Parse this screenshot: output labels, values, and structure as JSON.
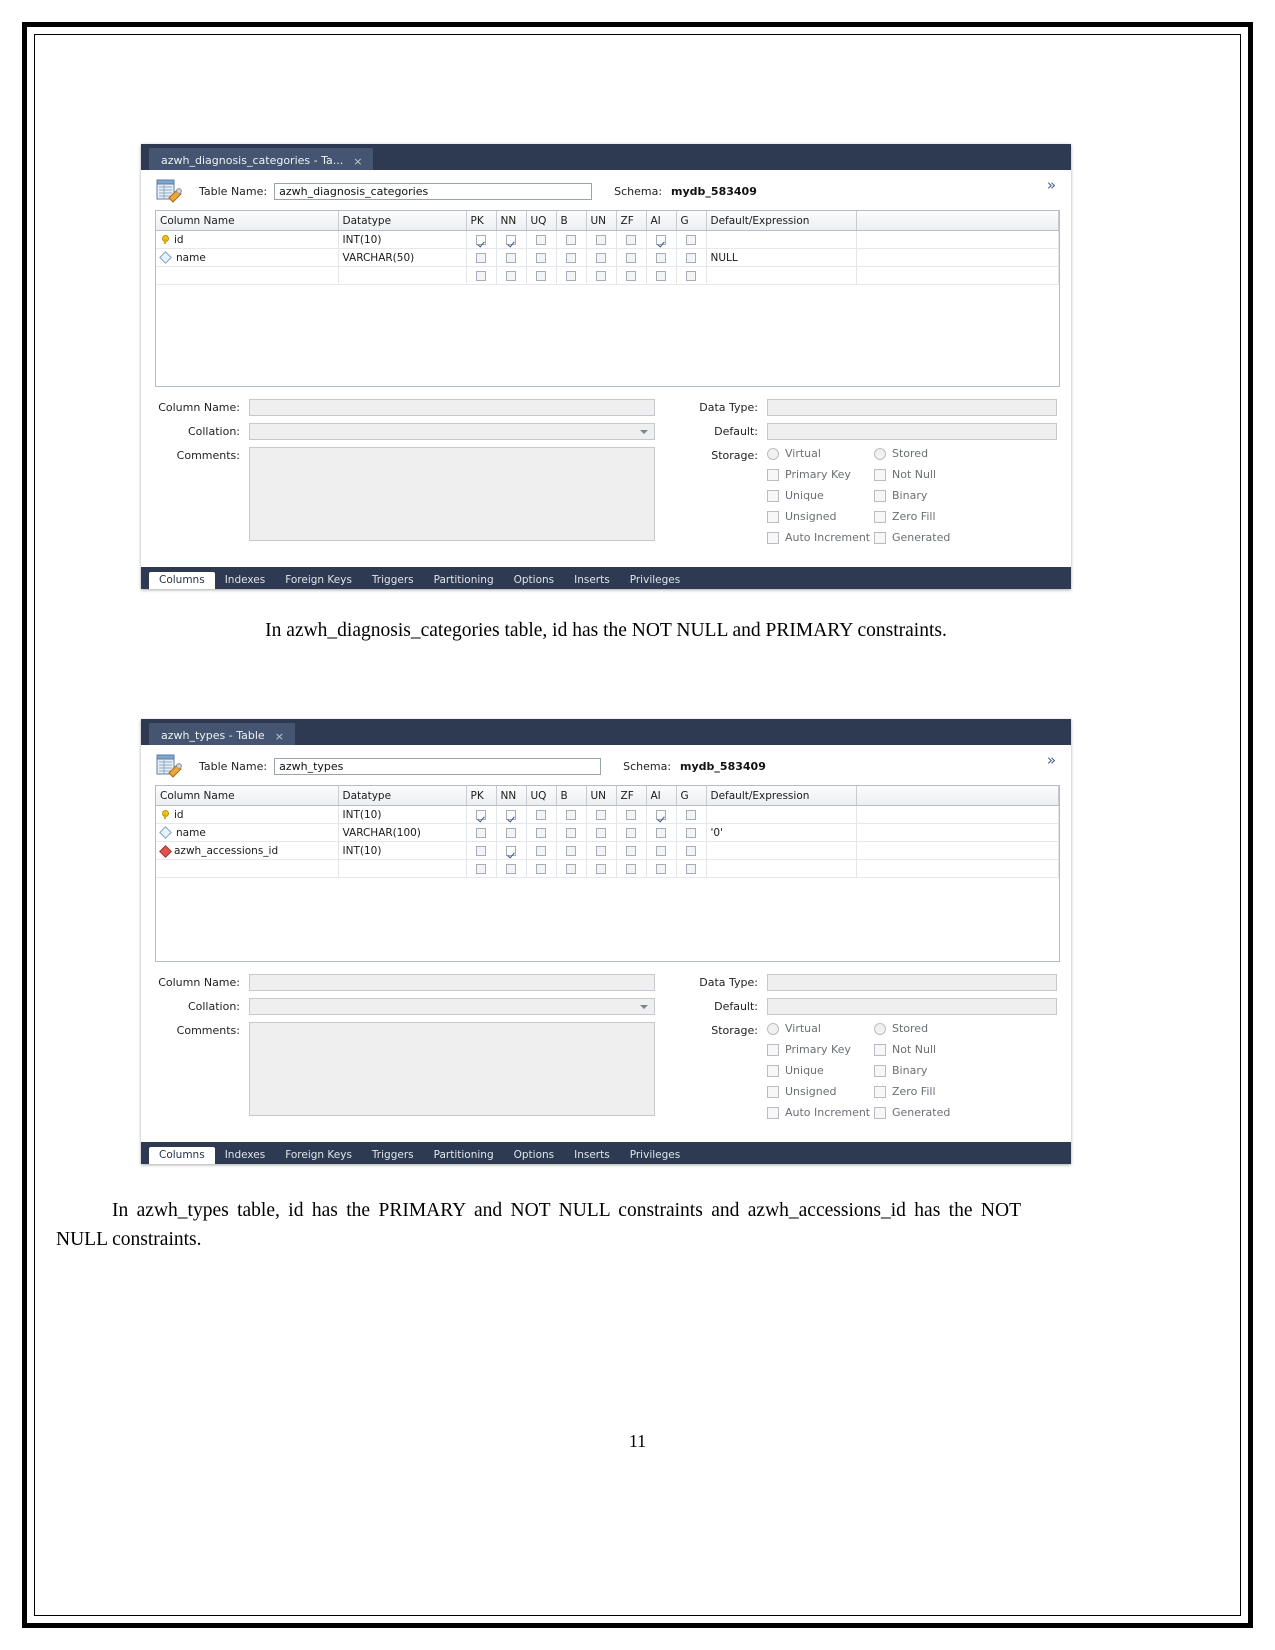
{
  "document": {
    "page_number": "11"
  },
  "figure1": {
    "tab_title": "azwh_diagnosis_categories - Ta...",
    "close_glyph": "×",
    "table_name_label": "Table Name:",
    "table_name_value": "azwh_diagnosis_categories",
    "schema_label": "Schema:",
    "schema_value": "mydb_583409",
    "collapse_glyph": "»",
    "grid": {
      "headers": [
        "Column Name",
        "Datatype",
        "PK",
        "NN",
        "UQ",
        "B",
        "UN",
        "ZF",
        "AI",
        "G",
        "Default/Expression"
      ],
      "rows": [
        {
          "icon": "primary-key-icon",
          "name": "id",
          "datatype": "INT(10)",
          "pk": true,
          "nn": true,
          "uq": false,
          "b": false,
          "un": false,
          "zf": false,
          "ai": true,
          "g": false,
          "default": ""
        },
        {
          "icon": "nullable-icon",
          "name": "name",
          "datatype": "VARCHAR(50)",
          "pk": false,
          "nn": false,
          "uq": false,
          "b": false,
          "un": false,
          "zf": false,
          "ai": false,
          "g": false,
          "default": "NULL"
        },
        {
          "icon": "",
          "name": "",
          "datatype": "",
          "pk": false,
          "nn": false,
          "uq": false,
          "b": false,
          "un": false,
          "zf": false,
          "ai": false,
          "g": false,
          "default": ""
        }
      ]
    },
    "detail": {
      "column_name_label": "Column Name:",
      "column_name_value": "",
      "collation_label": "Collation:",
      "collation_value": "",
      "comments_label": "Comments:",
      "comments_value": "",
      "data_type_label": "Data Type:",
      "data_type_value": "",
      "default_label": "Default:",
      "default_value": "",
      "storage_label": "Storage:",
      "options": [
        {
          "kind": "radio",
          "label": "Virtual",
          "checked": false
        },
        {
          "kind": "radio",
          "label": "Stored",
          "checked": false
        },
        {
          "kind": "checkbox",
          "label": "Primary Key",
          "checked": false
        },
        {
          "kind": "checkbox",
          "label": "Not Null",
          "checked": false
        },
        {
          "kind": "checkbox",
          "label": "Unique",
          "checked": false
        },
        {
          "kind": "checkbox",
          "label": "Binary",
          "checked": false
        },
        {
          "kind": "checkbox",
          "label": "Unsigned",
          "checked": false
        },
        {
          "kind": "checkbox",
          "label": "Zero Fill",
          "checked": false
        },
        {
          "kind": "checkbox",
          "label": "Auto Increment",
          "checked": false
        },
        {
          "kind": "checkbox",
          "label": "Generated",
          "checked": false
        }
      ]
    },
    "bottom_tabs": [
      {
        "label": "Columns",
        "active": true
      },
      {
        "label": "Indexes",
        "active": false
      },
      {
        "label": "Foreign Keys",
        "active": false
      },
      {
        "label": "Triggers",
        "active": false
      },
      {
        "label": "Partitioning",
        "active": false
      },
      {
        "label": "Options",
        "active": false
      },
      {
        "label": "Inserts",
        "active": false
      },
      {
        "label": "Privileges",
        "active": false
      }
    ],
    "caption": "In azwh_diagnosis_categories table, id has the NOT NULL and PRIMARY constraints."
  },
  "figure2": {
    "tab_title": "azwh_types - Table",
    "close_glyph": "×",
    "table_name_label": "Table Name:",
    "table_name_value": "azwh_types",
    "schema_label": "Schema:",
    "schema_value": "mydb_583409",
    "collapse_glyph": "»",
    "grid": {
      "headers": [
        "Column Name",
        "Datatype",
        "PK",
        "NN",
        "UQ",
        "B",
        "UN",
        "ZF",
        "AI",
        "G",
        "Default/Expression"
      ],
      "rows": [
        {
          "icon": "primary-key-icon",
          "name": "id",
          "datatype": "INT(10)",
          "pk": true,
          "nn": true,
          "uq": false,
          "b": false,
          "un": false,
          "zf": false,
          "ai": true,
          "g": false,
          "default": ""
        },
        {
          "icon": "nullable-icon",
          "name": "name",
          "datatype": "VARCHAR(100)",
          "pk": false,
          "nn": false,
          "uq": false,
          "b": false,
          "un": false,
          "zf": false,
          "ai": false,
          "g": false,
          "default": "'0'"
        },
        {
          "icon": "foreign-key-icon",
          "name": "azwh_accessions_id",
          "datatype": "INT(10)",
          "pk": false,
          "nn": true,
          "uq": false,
          "b": false,
          "un": false,
          "zf": false,
          "ai": false,
          "g": false,
          "default": ""
        },
        {
          "icon": "",
          "name": "",
          "datatype": "",
          "pk": false,
          "nn": false,
          "uq": false,
          "b": false,
          "un": false,
          "zf": false,
          "ai": false,
          "g": false,
          "default": ""
        }
      ]
    },
    "detail": {
      "column_name_label": "Column Name:",
      "column_name_value": "",
      "collation_label": "Collation:",
      "collation_value": "",
      "comments_label": "Comments:",
      "comments_value": "",
      "data_type_label": "Data Type:",
      "data_type_value": "",
      "default_label": "Default:",
      "default_value": "",
      "storage_label": "Storage:",
      "options": [
        {
          "kind": "radio",
          "label": "Virtual",
          "checked": false
        },
        {
          "kind": "radio",
          "label": "Stored",
          "checked": false
        },
        {
          "kind": "checkbox",
          "label": "Primary Key",
          "checked": false
        },
        {
          "kind": "checkbox",
          "label": "Not Null",
          "checked": false
        },
        {
          "kind": "checkbox",
          "label": "Unique",
          "checked": false
        },
        {
          "kind": "checkbox",
          "label": "Binary",
          "checked": false
        },
        {
          "kind": "checkbox",
          "label": "Unsigned",
          "checked": false
        },
        {
          "kind": "checkbox",
          "label": "Zero Fill",
          "checked": false
        },
        {
          "kind": "checkbox",
          "label": "Auto Increment",
          "checked": false
        },
        {
          "kind": "checkbox",
          "label": "Generated",
          "checked": false
        }
      ]
    },
    "bottom_tabs": [
      {
        "label": "Columns",
        "active": true
      },
      {
        "label": "Indexes",
        "active": false
      },
      {
        "label": "Foreign Keys",
        "active": false
      },
      {
        "label": "Triggers",
        "active": false
      },
      {
        "label": "Partitioning",
        "active": false
      },
      {
        "label": "Options",
        "active": false
      },
      {
        "label": "Inserts",
        "active": false
      },
      {
        "label": "Privileges",
        "active": false
      }
    ],
    "caption": "In azwh_types table, id has the PRIMARY and NOT NULL constraints and azwh_accessions_id has the NOT NULL constraints."
  }
}
